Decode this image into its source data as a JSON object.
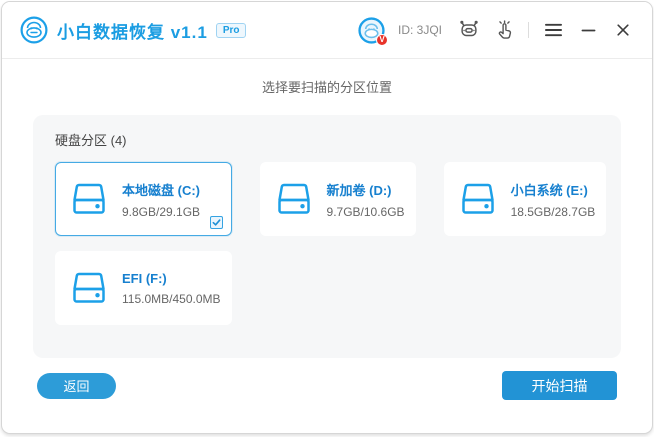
{
  "colors": {
    "accent_blue": "#1b9de2",
    "icon_blue": "#1ca0e8",
    "drive_name_blue": "#1780cf",
    "button_blue": "#2293d5",
    "panel_gray": "#f6f7f8",
    "badge_red": "#e8332a"
  },
  "titlebar": {
    "app_title": "小白数据恢复 v1.1",
    "pro_badge": "Pro",
    "user_id": "ID: 3JQI",
    "avatar_badge": "V",
    "icons": [
      "app-logo-icon",
      "avatar-icon",
      "robot-support-icon",
      "hand-tap-icon",
      "menu-icon",
      "minimize-icon",
      "close-icon"
    ]
  },
  "main": {
    "heading": "选择要扫描的分区位置",
    "panel_title": "硬盘分区 (4)",
    "drives": [
      {
        "name": "本地磁盘 (C:)",
        "size": "9.8GB/29.1GB",
        "selected": true
      },
      {
        "name": "新加卷 (D:)",
        "size": "9.7GB/10.6GB",
        "selected": false
      },
      {
        "name": "小白系统 (E:)",
        "size": "18.5GB/28.7GB",
        "selected": false
      },
      {
        "name": "EFI (F:)",
        "size": "115.0MB/450.0MB",
        "selected": false
      }
    ]
  },
  "footer": {
    "back_label": "返回",
    "scan_label": "开始扫描"
  }
}
